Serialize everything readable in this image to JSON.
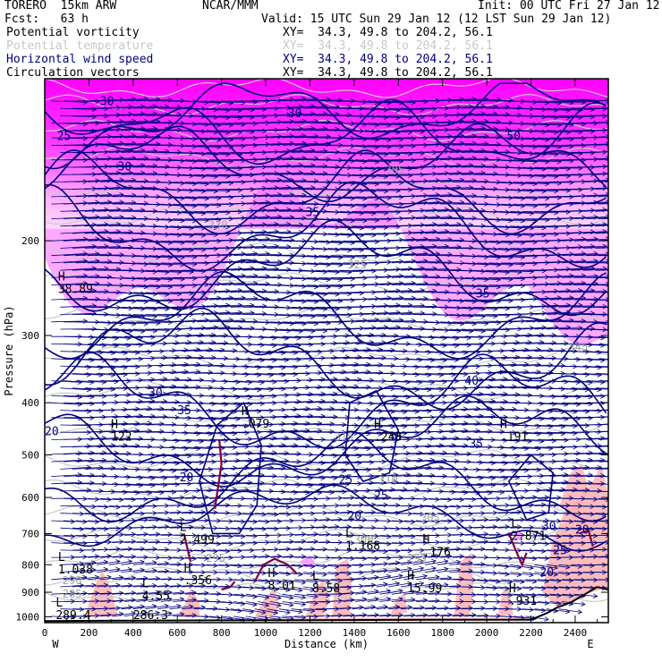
{
  "header": {
    "model": "TORERO  15km ARW",
    "org": "NCAR/MMM",
    "init": "Init: 00 UTC Fri 27 Jan 12",
    "fcst": "Fcst:   63 h",
    "valid": "Valid: 15 UTC Sun 29 Jan 12 (12 LST Sun 29 Jan 12)"
  },
  "legend": [
    {
      "label": "Potential vorticity",
      "xy": "XY=  34.3, 49.8 to 204.2, 56.1",
      "color": "#000000"
    },
    {
      "label": "Potential temperature",
      "xy": "XY=  34.3, 49.8 to 204.2, 56.1",
      "color": "#c8c8c8"
    },
    {
      "label": "Horizontal wind speed",
      "xy": "XY=  34.3, 49.8 to 204.2, 56.1",
      "color": "#000080"
    },
    {
      "label": "Circulation vectors",
      "xy": "XY=  34.3, 49.8 to 204.2, 56.1",
      "color": "#000000"
    }
  ],
  "chart_data": {
    "type": "cross-section",
    "xlabel": "Distance (km)",
    "ylabel": "Pressure (hPa)",
    "xlim": [
      0,
      2550
    ],
    "ylim": [
      100,
      1025
    ],
    "y_scale": "log",
    "x_ticks": [
      "0",
      "200",
      "400",
      "600",
      "800",
      "1000",
      "1200",
      "1400",
      "1600",
      "1800",
      "2000",
      "2200",
      "2400"
    ],
    "y_ticks": [
      "200",
      "300",
      "400",
      "500",
      "600",
      "700",
      "800",
      "900",
      "1000"
    ],
    "x_end_labels": {
      "left": "W",
      "right": "E"
    },
    "colors": {
      "wind_contour": "#000080",
      "pv_shading_high": "#ff00ff",
      "pv_shading_low": "#ffb0b0",
      "pv_contour": "#800040",
      "theta_contour": "#c8c8c8",
      "vectors": "#000080"
    },
    "wind_speed_labels": [
      {
        "text": "20",
        "x": 0,
        "p": 460
      },
      {
        "text": "25",
        "x": 55,
        "p": 130
      },
      {
        "text": "30",
        "x": 250,
        "p": 112
      },
      {
        "text": "30",
        "x": 330,
        "p": 148
      },
      {
        "text": "30",
        "x": 470,
        "p": 390
      },
      {
        "text": "35",
        "x": 600,
        "p": 420
      },
      {
        "text": "30",
        "x": 1100,
        "p": 118
      },
      {
        "text": "35",
        "x": 1180,
        "p": 180
      },
      {
        "text": "20",
        "x": 610,
        "p": 560
      },
      {
        "text": "35",
        "x": 1920,
        "p": 485
      },
      {
        "text": "30",
        "x": 1550,
        "p": 470
      },
      {
        "text": "25",
        "x": 1330,
        "p": 565
      },
      {
        "text": "25",
        "x": 1490,
        "p": 605
      },
      {
        "text": "20",
        "x": 1370,
        "p": 660
      },
      {
        "text": "50",
        "x": 2090,
        "p": 130
      },
      {
        "text": "40",
        "x": 1900,
        "p": 370
      },
      {
        "text": "35",
        "x": 1950,
        "p": 255
      },
      {
        "text": "30",
        "x": 2250,
        "p": 690
      },
      {
        "text": "25",
        "x": 2300,
        "p": 765
      },
      {
        "text": "20",
        "x": 2240,
        "p": 840
      },
      {
        "text": "20",
        "x": 2400,
        "p": 700
      }
    ],
    "extrema": [
      {
        "mark": "H",
        "x": 60,
        "p": 250,
        "value": "38.89"
      },
      {
        "mark": "H",
        "x": 300,
        "p": 470,
        "value": "122"
      },
      {
        "mark": "H",
        "x": 890,
        "p": 445,
        "value": ".079"
      },
      {
        "mark": "H",
        "x": 1490,
        "p": 470,
        "value": ".243"
      },
      {
        "mark": "H",
        "x": 2060,
        "p": 470,
        "value": ".191"
      },
      {
        "mark": "L",
        "x": 610,
        "p": 730,
        "value": "2.499"
      },
      {
        "mark": "L",
        "x": 1360,
        "p": 750,
        "value": "1.168"
      },
      {
        "mark": "H",
        "x": 1710,
        "p": 770,
        "value": ".176"
      },
      {
        "mark": "L",
        "x": 60,
        "p": 830,
        "value": "1.038"
      },
      {
        "mark": "L",
        "x": 2110,
        "p": 720,
        "value": "2.871"
      },
      {
        "mark": "H",
        "x": 630,
        "p": 870,
        "value": ".356"
      },
      {
        "mark": "H",
        "x": 1010,
        "p": 890,
        "value": "8.01"
      },
      {
        "mark": "L",
        "x": 1210,
        "p": 900,
        "value": "8.58"
      },
      {
        "mark": "H",
        "x": 1640,
        "p": 900,
        "value": "15.99"
      },
      {
        "mark": "L",
        "x": 440,
        "p": 930,
        "value": "4.55"
      },
      {
        "mark": "H",
        "x": 2100,
        "p": 950,
        "value": ".931"
      },
      {
        "mark": "L",
        "x": 50,
        "p": 1010,
        "value": "289.4"
      },
      {
        "mark": "",
        "x": 400,
        "p": 1010,
        "value": "286.3"
      }
    ],
    "theta_labels": [
      {
        "text": "315",
        "x": 1310,
        "p": 470
      },
      {
        "text": "310",
        "x": 1510,
        "p": 565
      },
      {
        "text": "305",
        "x": 1700,
        "p": 665
      },
      {
        "text": "300",
        "x": 1400,
        "p": 730
      },
      {
        "text": "295",
        "x": 730,
        "p": 790
      },
      {
        "text": "295",
        "x": 1640,
        "p": 790
      },
      {
        "text": "290",
        "x": 80,
        "p": 870
      },
      {
        "text": "285",
        "x": 80,
        "p": 920
      },
      {
        "text": "305",
        "x": 1540,
        "p": 150
      },
      {
        "text": "345",
        "x": 2370,
        "p": 320
      },
      {
        "text": "330",
        "x": 740,
        "p": 190
      },
      {
        "text": "325",
        "x": 1370,
        "p": 225
      }
    ]
  }
}
